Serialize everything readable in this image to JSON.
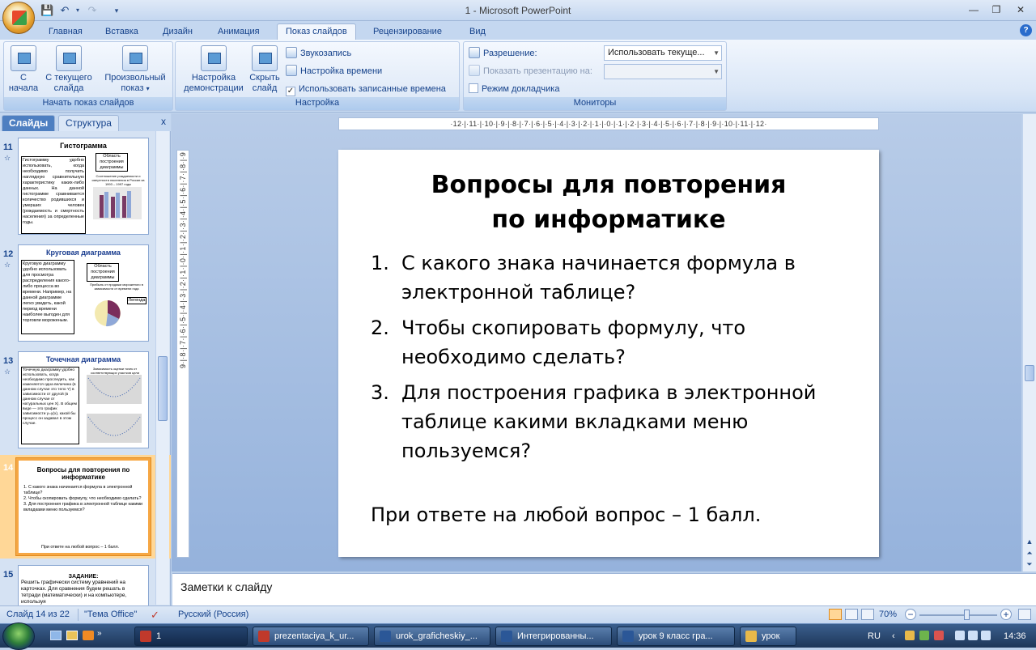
{
  "window": {
    "title": "1 - Microsoft PowerPoint"
  },
  "quick_access": {
    "save_icon": "save-icon",
    "undo_icon": "undo-icon",
    "redo_icon": "redo-icon"
  },
  "tabs": [
    "Главная",
    "Вставка",
    "Дизайн",
    "Анимация",
    "Показ слайдов",
    "Рецензирование",
    "Вид"
  ],
  "active_tab": "Показ слайдов",
  "ribbon": {
    "start_group": {
      "label": "Начать показ слайдов",
      "from_start": [
        "С",
        "начала"
      ],
      "from_current": [
        "С текущего",
        "слайда"
      ],
      "custom": [
        "Произвольный",
        "показ"
      ]
    },
    "setup_group": {
      "label": "Настройка",
      "setup_show": [
        "Настройка",
        "демонстрации"
      ],
      "hide_slide": [
        "Скрыть",
        "слайд"
      ],
      "record_narration": "Звукозапись",
      "rehearse_timings": "Настройка времени",
      "use_timings": "Использовать записанные времена",
      "use_timings_checked": true
    },
    "monitors_group": {
      "label": "Мониторы",
      "resolution_label": "Разрешение:",
      "resolution_value": "Использовать текуще...",
      "show_on_label": "Показать презентацию на:",
      "show_on_value": "",
      "presenter_view": "Режим докладчика",
      "presenter_view_checked": false
    }
  },
  "slide_pane": {
    "tab_slides": "Слайды",
    "tab_outline": "Структура",
    "close": "x",
    "thumbnails": [
      {
        "num": "11",
        "title": "Гистограмма",
        "text": "Гистограмму удобно использовать, когда необходимо получить наглядную сравнительную характеристику каких-либо данных. На данной гистограмме сравнивается количество родившихся и умерших человек (рождаемость и смертность населения) за определенные годы.",
        "callout": "Область построения диаграммы",
        "chart_caption": "Соотношение рождаемости и смертности населения в России за 1993 – 1997 годы"
      },
      {
        "num": "12",
        "title": "Круговая диаграмма",
        "text": "Круговую диаграмму удобно использовать для просмотра распределения какого-либо процесса во времени. Например, на данной диаграмме легко увидеть, какой период времени наиболее выгоден для торговли мороженым.",
        "callout": "Область построения диаграммы",
        "chart_caption": "Прибыль от продажи мороженого в зависимости от времени года",
        "legend": "Легенда"
      },
      {
        "num": "13",
        "title": "Точечная диаграмма",
        "text": "Точечную диаграмму удобно использовать, когда необходимо проследить, как изменяется одна величина (в данном случае это тело Y) в зависимости от другой (в данном случае от натуральных цен X). В общем виде — это график зависимости y=y(x), какой бы процесс он задавал в этом случае.",
        "chart_caption": "Зависимость оценки точек от соответствующих участков цели"
      },
      {
        "num": "14",
        "title": "Вопросы для повторения по информатике",
        "items": [
          "С какого знака начинается формула в электронной таблице?",
          "Чтобы скопировать формулу, что необходимо сделать?",
          "Для построения графика в электронной таблице какими вкладками меню пользуемся?"
        ],
        "footer": "При ответе на любой вопрос – 1 балл."
      },
      {
        "num": "15",
        "title": "ЗАДАНИЕ:",
        "text": "Решить графически систему уравнений на карточках. Для сравнения будем решать в тетради (математически) и на компьютере, используя"
      }
    ]
  },
  "ruler": {
    "horizontal": "·12·|·11·|·10·|·9·|·8·|·7·|·6·|·5·|·4·|·3·|·2·|·1·|·0·|·1·|·2·|·3·|·4·|·5·|·6·|·7·|·8·|·9·|·10·|·11·|·12·",
    "vertical": "9·|·8·|·7·|·6·|·5·|·4·|·3·|·2·|·1·|·0·|·1·|·2·|·3·|·4·|·5·|·6·|·7·|·8·|·9"
  },
  "slide": {
    "title_line1": "Вопросы для повторения",
    "title_line2": "по информатике",
    "questions": [
      {
        "num": "1.",
        "line1": "С какого знака начинается формула в",
        "line2": "электронной таблице?"
      },
      {
        "num": "2.",
        "line1": "Чтобы скопировать формулу, что",
        "line2": "необходимо сделать?"
      },
      {
        "num": "3.",
        "line1": "Для построения графика в электронной",
        "line2": "таблице какими вкладками меню",
        "line3": "пользуемся?"
      }
    ],
    "footer": "При ответе на любой вопрос – 1 балл."
  },
  "notes": {
    "placeholder": "Заметки к слайду"
  },
  "status": {
    "slide_info": "Слайд 14 из 22",
    "theme": "\"Тема Office\"",
    "language": "Русский (Россия)",
    "zoom": "70%",
    "zoom_level": 0.6
  },
  "taskbar": {
    "items": [
      {
        "label": "1",
        "active": true,
        "color": "#c0392b"
      },
      {
        "label": "prezentaciya_k_ur...",
        "active": false,
        "color": "#c0392b"
      },
      {
        "label": "urok_graficheskiy_...",
        "active": false,
        "color": "#2b5797"
      },
      {
        "label": "Интегрированны...",
        "active": false,
        "color": "#2b5797"
      },
      {
        "label": "урок 9 класс гра...",
        "active": false,
        "color": "#2b5797"
      },
      {
        "label": "урок",
        "active": false,
        "color": "#e8b94a"
      }
    ],
    "lang": "RU",
    "time": "14:36"
  },
  "colors": {
    "accent": "#15428b",
    "ribbon_bg": "#dbe7f7",
    "selected_thumb": "#f6a744"
  }
}
